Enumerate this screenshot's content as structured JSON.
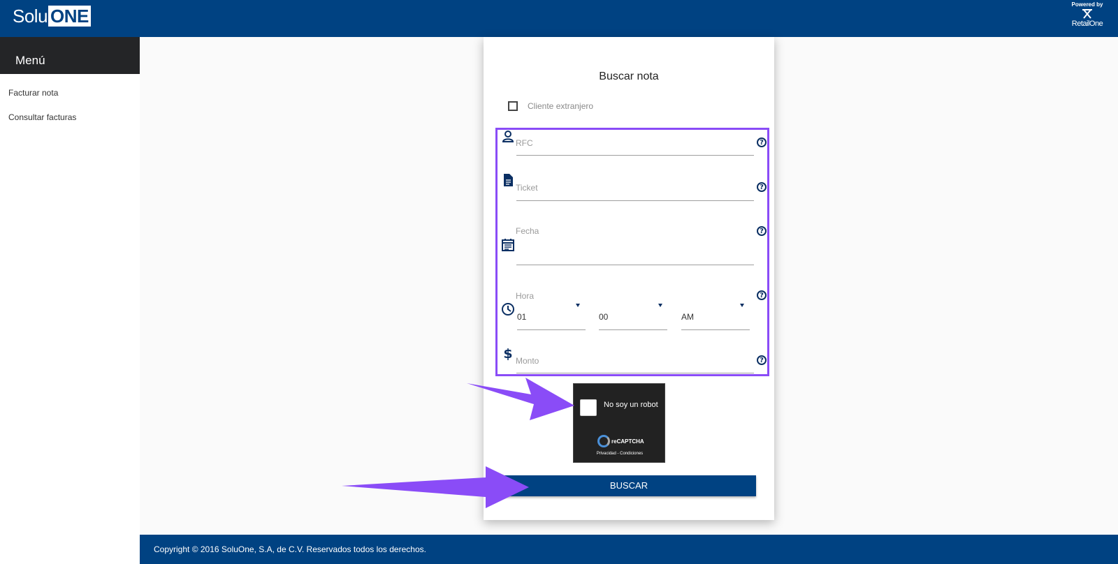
{
  "header": {
    "logo_text_left": "Solu",
    "logo_text_boxed": "ONE",
    "powered_by": "Powered by",
    "retail_one": "RetailOne"
  },
  "sidebar": {
    "title": "Menú",
    "items": [
      {
        "label": "Facturar nota"
      },
      {
        "label": "Consultar facturas"
      }
    ]
  },
  "form": {
    "title": "Buscar nota",
    "foreign_client_label": "Cliente extranjero",
    "fields": {
      "rfc": {
        "label": "RFC",
        "icon": "person-icon"
      },
      "ticket": {
        "label": "Ticket",
        "icon": "document-icon"
      },
      "fecha": {
        "label": "Fecha",
        "icon": "calendar-icon"
      },
      "hora": {
        "label": "Hora",
        "icon": "clock-icon",
        "hour": "01",
        "minute": "00",
        "ampm": "AM"
      },
      "monto": {
        "label": "Monto",
        "icon": "dollar-icon"
      }
    },
    "help_icon": "?",
    "search_button": "BUSCAR"
  },
  "captcha": {
    "text": "No soy un robot",
    "brand": "reCAPTCHA",
    "links": "Privacidad - Condiciones"
  },
  "footer": {
    "copyright": "Copyright © 2016 SoluOne, S.A, de C.V. Reservados todos los derechos."
  },
  "colors": {
    "brand_blue": "#004282",
    "highlight_purple": "#8a4cf7",
    "arrow_purple": "#8a4cf7",
    "menu_dark": "#242527"
  }
}
